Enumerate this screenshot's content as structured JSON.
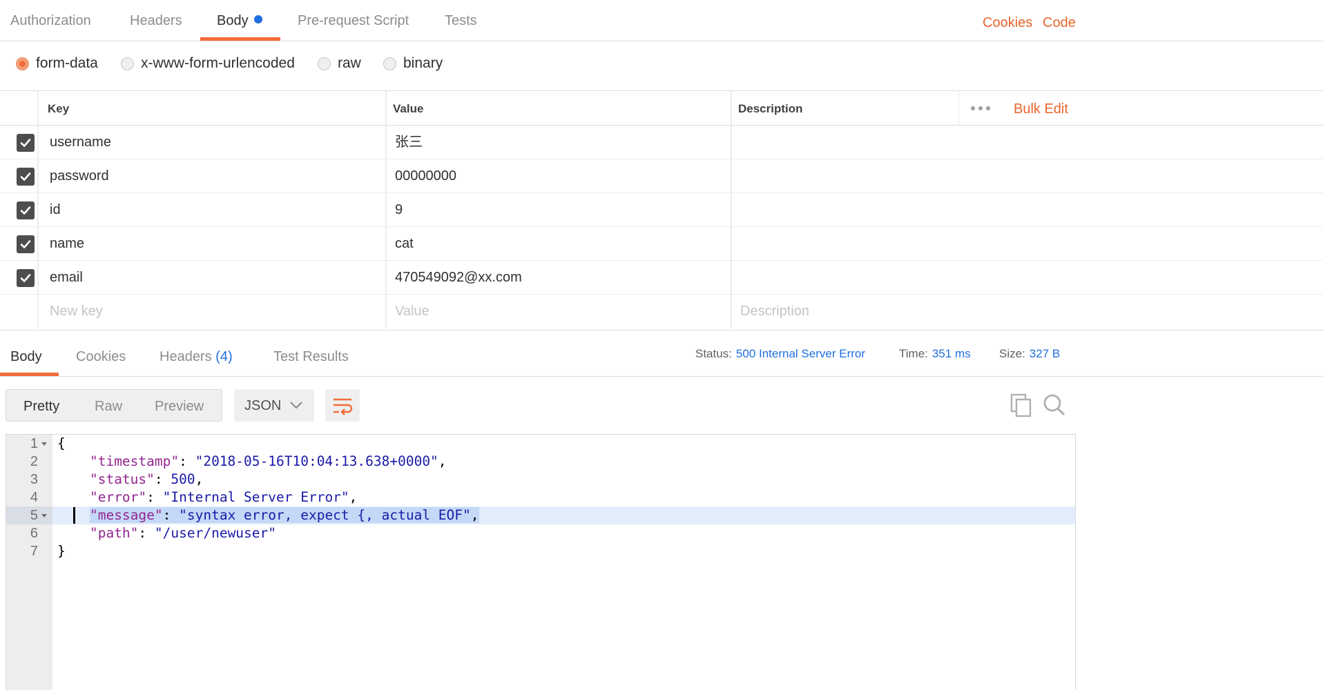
{
  "request_tabs": {
    "authorization": "Authorization",
    "headers": "Headers",
    "body": "Body",
    "prerequest": "Pre-request Script",
    "tests": "Tests",
    "cookies_link": "Cookies",
    "code_link": "Code"
  },
  "body_types": {
    "form_data": "form-data",
    "urlencoded": "x-www-form-urlencoded",
    "raw": "raw",
    "binary": "binary",
    "selected": "form-data"
  },
  "kv_table": {
    "headers": {
      "key": "Key",
      "value": "Value",
      "description": "Description"
    },
    "bulk_edit": "Bulk Edit",
    "rows": [
      {
        "key": "username",
        "value": "张三",
        "checked": true
      },
      {
        "key": "password",
        "value": "00000000",
        "checked": true
      },
      {
        "key": "id",
        "value": "9",
        "checked": true
      },
      {
        "key": "name",
        "value": "cat",
        "checked": true
      },
      {
        "key": "email",
        "value": "470549092@xx.com",
        "checked": true
      }
    ],
    "new_row": {
      "key_placeholder": "New key",
      "value_placeholder": "Value",
      "description_placeholder": "Description"
    }
  },
  "response_tabs": {
    "body": "Body",
    "cookies": "Cookies",
    "headers": "Headers",
    "headers_count": "(4)",
    "test_results": "Test Results"
  },
  "status": {
    "status_label": "Status:",
    "status_value": "500 Internal Server Error",
    "time_label": "Time:",
    "time_value": "351 ms",
    "size_label": "Size:",
    "size_value": "327 B"
  },
  "view": {
    "pretty": "Pretty",
    "raw": "Raw",
    "preview": "Preview",
    "format": "JSON"
  },
  "icons": {
    "wrap": "wrap-lines-icon",
    "copy": "copy-icon",
    "search": "search-icon",
    "chevron": "chevron-down-icon",
    "more": "more-dots-icon",
    "check": "checkbox-checked-icon"
  },
  "response_body": {
    "line_numbers": [
      "1",
      "2",
      "3",
      "4",
      "5",
      "6",
      "7"
    ],
    "timestamp_key": "\"timestamp\"",
    "timestamp_value": "\"2018-05-16T10:04:13.638+0000\"",
    "status_key": "\"status\"",
    "status_value": "500",
    "error_key": "\"error\"",
    "error_value": "\"Internal Server Error\"",
    "message_key": "\"message\"",
    "message_value": "\"syntax error, expect {, actual EOF\"",
    "path_key": "\"path\"",
    "path_value": "\"/user/newuser\""
  },
  "colors": {
    "accent": "#f26b3a",
    "link": "#1f6fe0",
    "json_key": "#92278f",
    "json_value": "#1a1aa6"
  }
}
